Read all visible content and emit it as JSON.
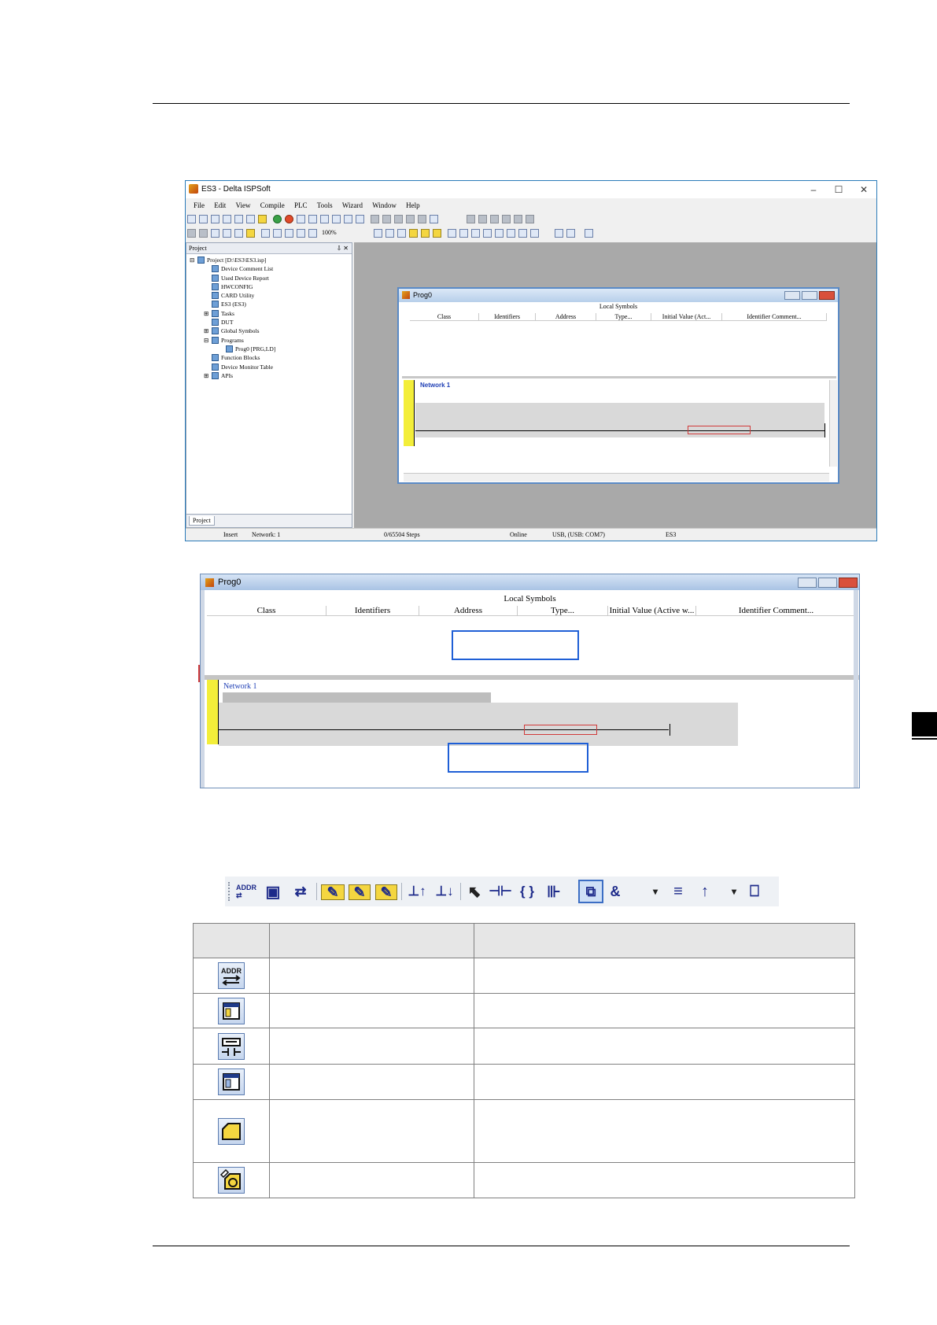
{
  "main_window": {
    "title": "ES3 - Delta ISPSoft",
    "controls": [
      "–",
      "☐",
      "✕"
    ],
    "menu": [
      "File",
      "Edit",
      "View",
      "Compile",
      "PLC",
      "Tools",
      "Wizard",
      "Window",
      "Help"
    ],
    "zoom": "100%",
    "project_pane": {
      "header": "Project",
      "pin": "⇩ ✕",
      "tree": [
        {
          "label": "Project [D:\\ES3\\ES3.isp]",
          "indent": 0,
          "expander": "⊟"
        },
        {
          "label": "Device Comment List",
          "indent": 2,
          "expander": ""
        },
        {
          "label": "Used Device Report",
          "indent": 2,
          "expander": ""
        },
        {
          "label": "HWCONFIG",
          "indent": 2,
          "expander": ""
        },
        {
          "label": "CARD Utility",
          "indent": 2,
          "expander": ""
        },
        {
          "label": "ES3 (ES3)",
          "indent": 2,
          "expander": ""
        },
        {
          "label": "Tasks",
          "indent": 2,
          "expander": "⊞"
        },
        {
          "label": "DUT",
          "indent": 2,
          "expander": ""
        },
        {
          "label": "Global Symbols",
          "indent": 2,
          "expander": "⊞"
        },
        {
          "label": "Programs",
          "indent": 2,
          "expander": "⊟"
        },
        {
          "label": "Prog0 [PRG,LD]",
          "indent": 4,
          "expander": ""
        },
        {
          "label": "Function Blocks",
          "indent": 2,
          "expander": ""
        },
        {
          "label": "Device Monitor Table",
          "indent": 2,
          "expander": ""
        },
        {
          "label": "APIs",
          "indent": 2,
          "expander": "⊞"
        }
      ],
      "tab": "Project"
    },
    "status_bar": {
      "mode": "Insert",
      "network": "Network: 1",
      "steps": "0/65504 Steps",
      "online": "Online",
      "comm": "USB, (USB: COM7)",
      "device": "ES3"
    }
  },
  "prog_window": {
    "title": "Prog0",
    "local_symbols_header": "Local Symbols",
    "columns": [
      "Class",
      "Identifiers",
      "Address",
      "Type...",
      "Initial Value (Active w...",
      "Identifier Comment..."
    ],
    "small_columns": [
      "Class",
      "Identifiers",
      "Address",
      "Type...",
      "Initial Value (Act...",
      "Identifier Comment..."
    ],
    "network_label": "Network 1",
    "network_label_big": "Network 1"
  },
  "ladder_toolbar": {
    "icons": [
      "addr-swap-icon",
      "symbol-table-icon",
      "device-comment-icon",
      "comment-icon",
      "comment-edit-icon",
      "comment-hide-icon",
      "network-insert-above-icon",
      "network-insert-below-icon",
      "select-pointer-icon",
      "contact-icon",
      "coil-icon",
      "api-icon",
      "network-view-icon",
      "and-icon",
      "parallel-icon",
      "upward-icon",
      "block-icon"
    ],
    "glyphs": [
      "ADDR ⇄",
      "▣",
      "⇄",
      "✎",
      "✎",
      "✎",
      "⊥↑",
      "⊥↓",
      "⬉",
      "⊣⊢",
      "{ }",
      "⊪",
      "⧉",
      "&",
      "≡",
      "↑",
      "⎕"
    ],
    "dropdowns": [
      "▾",
      "▾"
    ]
  },
  "icon_table": {
    "header": [
      "",
      "",
      ""
    ],
    "rows": [
      {
        "icon": "addr-swap-icon",
        "name": "",
        "desc": ""
      },
      {
        "icon": "symbol-table-icon",
        "name": "",
        "desc": ""
      },
      {
        "icon": "device-comment-icon",
        "name": "",
        "desc": ""
      },
      {
        "icon": "symbol-table-icon",
        "name": "",
        "desc": ""
      },
      {
        "icon": "comment-icon",
        "name": "",
        "desc": ""
      },
      {
        "icon": "comment-edit-icon",
        "name": "",
        "desc": ""
      }
    ]
  },
  "colors": {
    "accent_blue": "#1f5fd6",
    "network_bar": "#f3ee3a",
    "mdi_gray": "#a9a9a9",
    "highlight_red": "#d03a3a"
  }
}
